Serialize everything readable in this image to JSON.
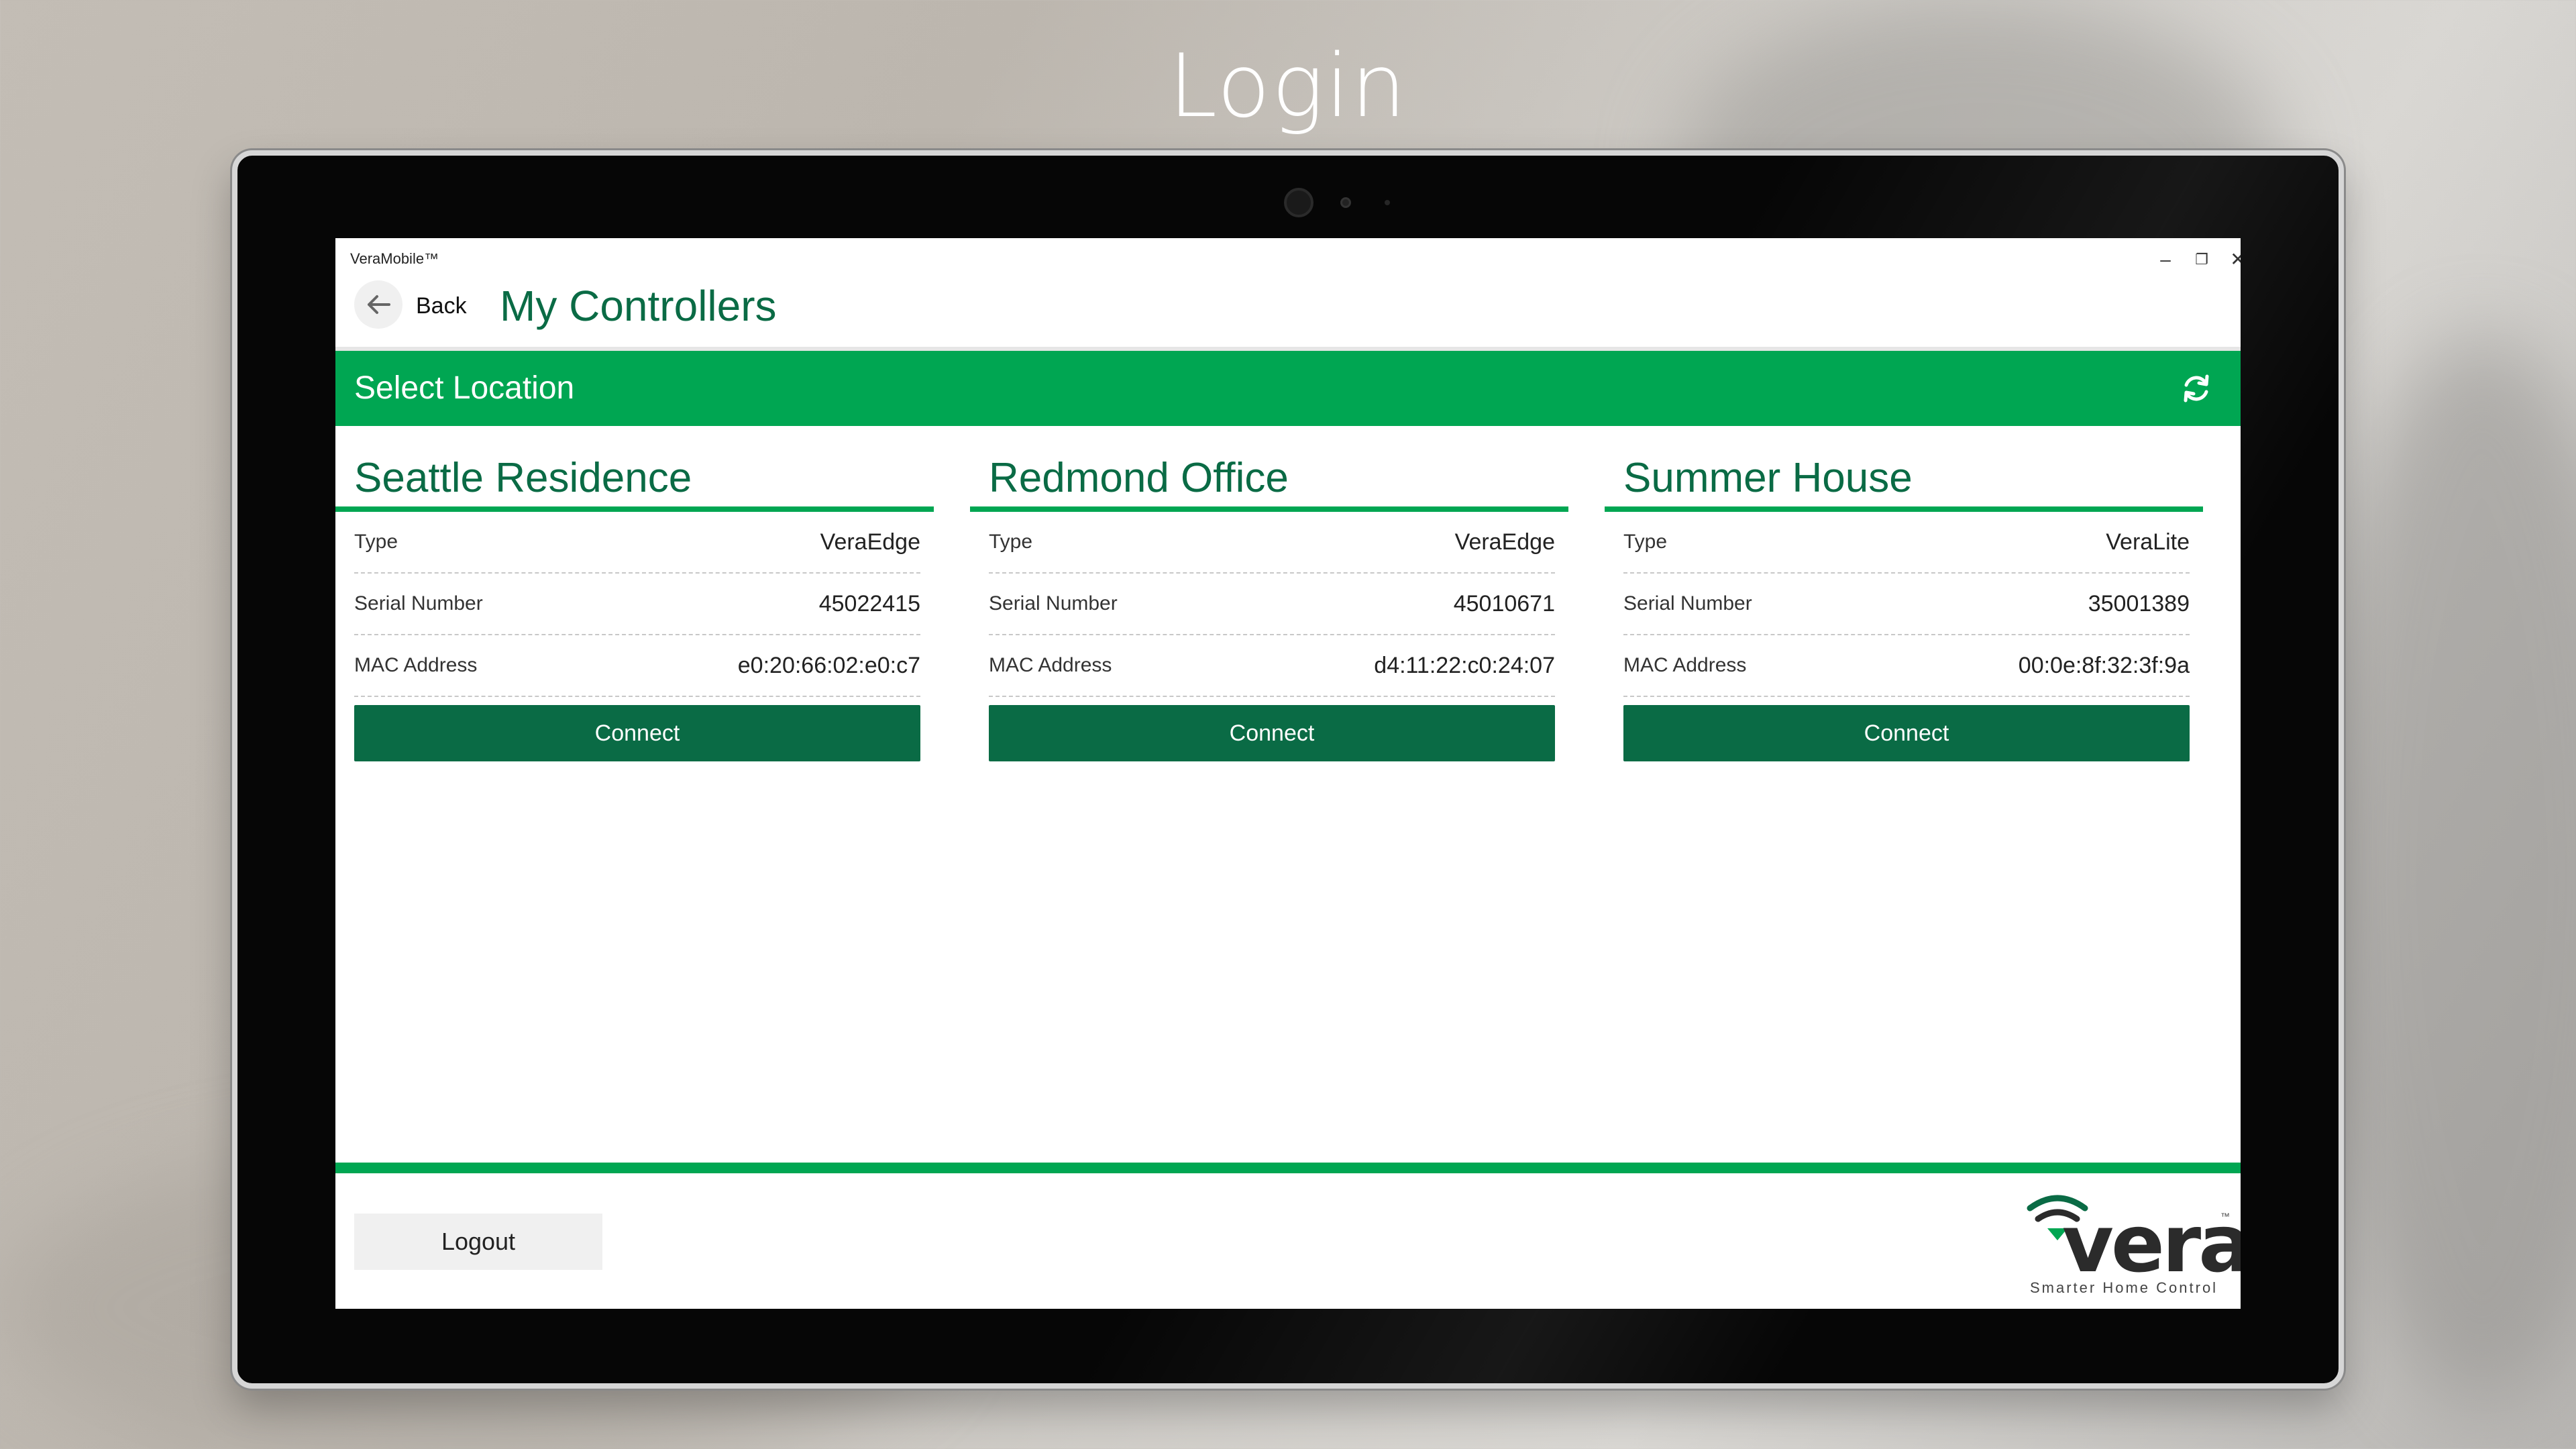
{
  "promo": {
    "title": "Login"
  },
  "window": {
    "app_name": "VeraMobile™",
    "controls": {
      "minimize": "–",
      "restore": "❐",
      "close": "✕"
    }
  },
  "header": {
    "back_label": "Back",
    "back_icon": "arrow-left-icon",
    "title": "My Controllers"
  },
  "location_bar": {
    "title": "Select Location",
    "refresh_icon": "refresh-icon"
  },
  "labels": {
    "type": "Type",
    "serial": "Serial Number",
    "mac": "MAC Address",
    "connect": "Connect"
  },
  "controllers": [
    {
      "name": "Seattle Residence",
      "type": "VeraEdge",
      "serial": "45022415",
      "mac": "e0:20:66:02:e0:c7"
    },
    {
      "name": "Redmond Office",
      "type": "VeraEdge",
      "serial": "45010671",
      "mac": "d4:11:22:c0:24:07"
    },
    {
      "name": "Summer House",
      "type": "VeraLite",
      "serial": "35001389",
      "mac": "00:0e:8f:32:3f:9a"
    }
  ],
  "footer": {
    "logout_label": "Logout",
    "logo": {
      "wordmark": "vera",
      "tm": "™",
      "tagline": "Smarter Home Control"
    }
  },
  "colors": {
    "brand_green": "#00a652",
    "dark_green": "#0a6b45",
    "button_gray": "#f0f0f0"
  }
}
